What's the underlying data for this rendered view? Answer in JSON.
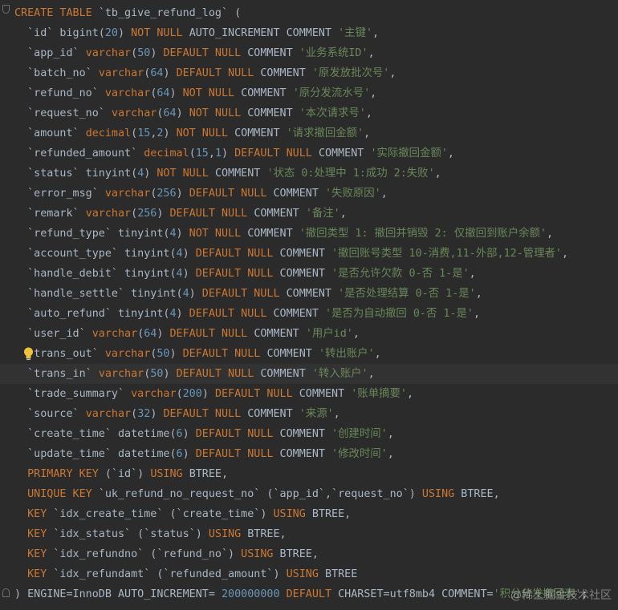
{
  "colors": {
    "background": "#2b2b2b",
    "keyword": "#cc7832",
    "string": "#6a8759",
    "number": "#6897bb",
    "identifier": "#a9b7c6",
    "current_line": "#323232"
  },
  "icons": {
    "fold_top": "fold-marker-icon",
    "fold_bottom": "fold-marker-end-icon",
    "intention": "lightbulb-icon"
  },
  "editor": {
    "highlighted_line_index": 18,
    "lines": [
      [
        [
          "k",
          "CREATE TABLE "
        ],
        [
          "p",
          "`tb_give_refund_log` ("
        ]
      ],
      [
        [
          "p",
          "  `id` bigint("
        ],
        [
          "n",
          "20"
        ],
        [
          "p",
          ") "
        ],
        [
          "k",
          "NOT NULL "
        ],
        [
          "p",
          "AUTO_INCREMENT COMMENT "
        ],
        [
          "s",
          "'主键'"
        ],
        [
          "p",
          ","
        ]
      ],
      [
        [
          "p",
          "  `app_id` "
        ],
        [
          "k",
          "varchar"
        ],
        [
          "p",
          "("
        ],
        [
          "n",
          "50"
        ],
        [
          "p",
          ") "
        ],
        [
          "k",
          "DEFAULT NULL "
        ],
        [
          "p",
          "COMMENT "
        ],
        [
          "s",
          "'业务系统ID'"
        ],
        [
          "p",
          ","
        ]
      ],
      [
        [
          "p",
          "  `batch_no` "
        ],
        [
          "k",
          "varchar"
        ],
        [
          "p",
          "("
        ],
        [
          "n",
          "64"
        ],
        [
          "p",
          ") "
        ],
        [
          "k",
          "DEFAULT NULL "
        ],
        [
          "p",
          "COMMENT "
        ],
        [
          "s",
          "'原发放批次号'"
        ],
        [
          "p",
          ","
        ]
      ],
      [
        [
          "p",
          "  `refund_no` "
        ],
        [
          "k",
          "varchar"
        ],
        [
          "p",
          "("
        ],
        [
          "n",
          "64"
        ],
        [
          "p",
          ") "
        ],
        [
          "k",
          "NOT NULL "
        ],
        [
          "p",
          "COMMENT "
        ],
        [
          "s",
          "'原分发流水号'"
        ],
        [
          "p",
          ","
        ]
      ],
      [
        [
          "p",
          "  `request_no` "
        ],
        [
          "k",
          "varchar"
        ],
        [
          "p",
          "("
        ],
        [
          "n",
          "64"
        ],
        [
          "p",
          ") "
        ],
        [
          "k",
          "NOT NULL "
        ],
        [
          "p",
          "COMMENT "
        ],
        [
          "s",
          "'本次请求号'"
        ],
        [
          "p",
          ","
        ]
      ],
      [
        [
          "p",
          "  `amount` "
        ],
        [
          "k",
          "decimal"
        ],
        [
          "p",
          "("
        ],
        [
          "n",
          "15"
        ],
        [
          "p",
          ","
        ],
        [
          "n",
          "2"
        ],
        [
          "p",
          ") "
        ],
        [
          "k",
          "NOT NULL "
        ],
        [
          "p",
          "COMMENT "
        ],
        [
          "s",
          "'请求撤回金额'"
        ],
        [
          "p",
          ","
        ]
      ],
      [
        [
          "p",
          "  `refunded_amount` "
        ],
        [
          "k",
          "decimal"
        ],
        [
          "p",
          "("
        ],
        [
          "n",
          "15"
        ],
        [
          "p",
          ","
        ],
        [
          "n",
          "1"
        ],
        [
          "p",
          ") "
        ],
        [
          "k",
          "DEFAULT NULL "
        ],
        [
          "p",
          "COMMENT "
        ],
        [
          "s",
          "'实际撤回金额'"
        ],
        [
          "p",
          ","
        ]
      ],
      [
        [
          "p",
          "  `status` tinyint("
        ],
        [
          "n",
          "4"
        ],
        [
          "p",
          ") "
        ],
        [
          "k",
          "NOT NULL "
        ],
        [
          "p",
          "COMMENT "
        ],
        [
          "s",
          "'状态 0:处理中 1:成功 2:失败'"
        ],
        [
          "p",
          ","
        ]
      ],
      [
        [
          "p",
          "  `error_msg` "
        ],
        [
          "k",
          "varchar"
        ],
        [
          "p",
          "("
        ],
        [
          "n",
          "256"
        ],
        [
          "p",
          ") "
        ],
        [
          "k",
          "DEFAULT NULL "
        ],
        [
          "p",
          "COMMENT "
        ],
        [
          "s",
          "'失败原因'"
        ],
        [
          "p",
          ","
        ]
      ],
      [
        [
          "p",
          "  `remark` "
        ],
        [
          "k",
          "varchar"
        ],
        [
          "p",
          "("
        ],
        [
          "n",
          "256"
        ],
        [
          "p",
          ") "
        ],
        [
          "k",
          "DEFAULT NULL "
        ],
        [
          "p",
          "COMMENT "
        ],
        [
          "s",
          "'备注'"
        ],
        [
          "p",
          ","
        ]
      ],
      [
        [
          "p",
          "  `refund_type` tinyint("
        ],
        [
          "n",
          "4"
        ],
        [
          "p",
          ") "
        ],
        [
          "k",
          "NOT NULL "
        ],
        [
          "p",
          "COMMENT "
        ],
        [
          "s",
          "'撤回类型 1: 撤回并销毁 2: 仅撤回到账户余额'"
        ],
        [
          "p",
          ","
        ]
      ],
      [
        [
          "p",
          "  `account_type` tinyint("
        ],
        [
          "n",
          "4"
        ],
        [
          "p",
          ") "
        ],
        [
          "k",
          "DEFAULT NULL "
        ],
        [
          "p",
          "COMMENT "
        ],
        [
          "s",
          "'撤回账号类型 10-消费,11-外部,12-管理者'"
        ],
        [
          "p",
          ","
        ]
      ],
      [
        [
          "p",
          "  `handle_debit` tinyint("
        ],
        [
          "n",
          "4"
        ],
        [
          "p",
          ") "
        ],
        [
          "k",
          "DEFAULT NULL "
        ],
        [
          "p",
          "COMMENT "
        ],
        [
          "s",
          "'是否允许欠款 0-否 1-是'"
        ],
        [
          "p",
          ","
        ]
      ],
      [
        [
          "p",
          "  `handle_settle` tinyint("
        ],
        [
          "n",
          "4"
        ],
        [
          "p",
          ") "
        ],
        [
          "k",
          "DEFAULT NULL "
        ],
        [
          "p",
          "COMMENT "
        ],
        [
          "s",
          "'是否处理结算 0-否 1-是'"
        ],
        [
          "p",
          ","
        ]
      ],
      [
        [
          "p",
          "  `auto_refund` tinyint("
        ],
        [
          "n",
          "4"
        ],
        [
          "p",
          ") "
        ],
        [
          "k",
          "DEFAULT NULL "
        ],
        [
          "p",
          "COMMENT "
        ],
        [
          "s",
          "'是否为自动撤回 0-否 1-是'"
        ],
        [
          "p",
          ","
        ]
      ],
      [
        [
          "p",
          "  `user_id` "
        ],
        [
          "k",
          "varchar"
        ],
        [
          "p",
          "("
        ],
        [
          "n",
          "64"
        ],
        [
          "p",
          ") "
        ],
        [
          "k",
          "DEFAULT NULL "
        ],
        [
          "p",
          "COMMENT "
        ],
        [
          "s",
          "'用户id'"
        ],
        [
          "p",
          ","
        ]
      ],
      [
        [
          "p",
          "   trans_out` "
        ],
        [
          "k",
          "varchar"
        ],
        [
          "p",
          "("
        ],
        [
          "n",
          "50"
        ],
        [
          "p",
          ") "
        ],
        [
          "k",
          "DEFAULT NULL "
        ],
        [
          "p",
          "COMMENT "
        ],
        [
          "s",
          "'转出账户'"
        ],
        [
          "p",
          ","
        ]
      ],
      [
        [
          "p",
          "  `trans_in` "
        ],
        [
          "k",
          "varchar"
        ],
        [
          "p",
          "("
        ],
        [
          "n",
          "50"
        ],
        [
          "p",
          ") "
        ],
        [
          "k",
          "DEFAULT NULL "
        ],
        [
          "p",
          "COMMENT "
        ],
        [
          "s",
          "'转入账户'"
        ],
        [
          "p",
          ","
        ]
      ],
      [
        [
          "p",
          "  `trade_summary` "
        ],
        [
          "k",
          "varchar"
        ],
        [
          "p",
          "("
        ],
        [
          "n",
          "200"
        ],
        [
          "p",
          ") "
        ],
        [
          "k",
          "DEFAULT NULL "
        ],
        [
          "p",
          "COMMENT "
        ],
        [
          "s",
          "'账单摘要'"
        ],
        [
          "p",
          ","
        ]
      ],
      [
        [
          "p",
          "  `source` "
        ],
        [
          "k",
          "varchar"
        ],
        [
          "p",
          "("
        ],
        [
          "n",
          "32"
        ],
        [
          "p",
          ") "
        ],
        [
          "k",
          "DEFAULT NULL "
        ],
        [
          "p",
          "COMMENT "
        ],
        [
          "s",
          "'来源'"
        ],
        [
          "p",
          ","
        ]
      ],
      [
        [
          "p",
          "  `create_time` datetime("
        ],
        [
          "n",
          "6"
        ],
        [
          "p",
          ") "
        ],
        [
          "k",
          "DEFAULT NULL "
        ],
        [
          "p",
          "COMMENT "
        ],
        [
          "s",
          "'创建时间'"
        ],
        [
          "p",
          ","
        ]
      ],
      [
        [
          "p",
          "  `update_time` datetime("
        ],
        [
          "n",
          "6"
        ],
        [
          "p",
          ") "
        ],
        [
          "k",
          "DEFAULT NULL "
        ],
        [
          "p",
          "COMMENT "
        ],
        [
          "s",
          "'修改时间'"
        ],
        [
          "p",
          ","
        ]
      ],
      [
        [
          "p",
          "  "
        ],
        [
          "k",
          "PRIMARY KEY "
        ],
        [
          "p",
          "(`id`) "
        ],
        [
          "k",
          "USING "
        ],
        [
          "p",
          "BTREE,"
        ]
      ],
      [
        [
          "p",
          "  "
        ],
        [
          "k",
          "UNIQUE KEY "
        ],
        [
          "p",
          "`uk_refund_no_request_no` (`app_id`,`request_no`) "
        ],
        [
          "k",
          "USING "
        ],
        [
          "p",
          "BTREE,"
        ]
      ],
      [
        [
          "p",
          "  "
        ],
        [
          "k",
          "KEY "
        ],
        [
          "p",
          "`idx_create_time` (`create_time`) "
        ],
        [
          "k",
          "USING "
        ],
        [
          "p",
          "BTREE,"
        ]
      ],
      [
        [
          "p",
          "  "
        ],
        [
          "k",
          "KEY "
        ],
        [
          "p",
          "`idx_status` (`status`) "
        ],
        [
          "k",
          "USING "
        ],
        [
          "p",
          "BTREE,"
        ]
      ],
      [
        [
          "p",
          "  "
        ],
        [
          "k",
          "KEY "
        ],
        [
          "p",
          "`idx_refundno` (`refund_no`) "
        ],
        [
          "k",
          "USING "
        ],
        [
          "p",
          "BTREE,"
        ]
      ],
      [
        [
          "p",
          "  "
        ],
        [
          "k",
          "KEY "
        ],
        [
          "p",
          "`idx_refundamt` (`refunded_amount`) "
        ],
        [
          "k",
          "USING "
        ],
        [
          "p",
          "BTREE"
        ]
      ],
      [
        [
          "p",
          ") ENGINE=InnoDB AUTO_INCREMENT= "
        ],
        [
          "n",
          "200000000 "
        ],
        [
          "k",
          "DEFAULT "
        ],
        [
          "p",
          "CHARSET=utf8mb4 COMMENT="
        ],
        [
          "s",
          "'积分分发撤回表'"
        ],
        [
          "p",
          ";"
        ]
      ]
    ]
  },
  "watermark": "@稀土掘金技术社区"
}
